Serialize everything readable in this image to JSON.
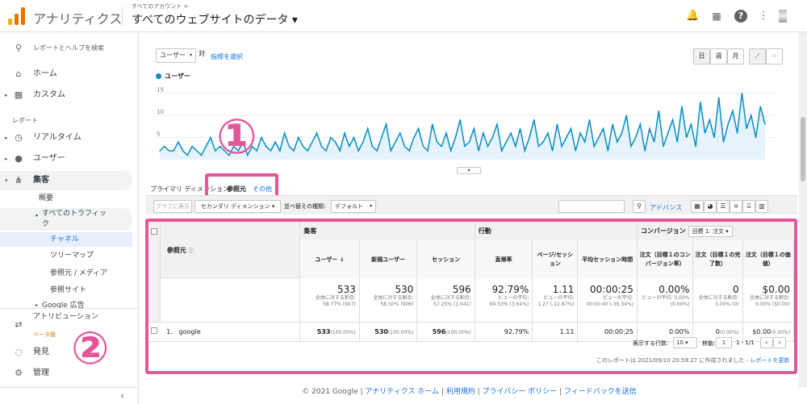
{
  "app": {
    "title": "アナリティクス",
    "account_small": "すべてのアカウント >",
    "property": "すべてのウェブサイトのデータ ▾"
  },
  "sidebar": {
    "search": "レポートとヘルプを検索",
    "home": "ホーム",
    "custom": "カスタム",
    "section_report": "レポート",
    "realtime": "リアルタイム",
    "users": "ユーザー",
    "acquisition": "集客",
    "overview": "概要",
    "all_traffic": "すべてのトラフィック",
    "channels": "チャネル",
    "treemap": "ツリーマップ",
    "source_medium": "参照元 / メディア",
    "referrals": "参照サイト",
    "google_ads": "Google 広告",
    "attribution": "アトリビューション",
    "beta": "ベータ版",
    "discover": "発見",
    "admin": "管理"
  },
  "chart_controls": {
    "metric_select": "ユーザー",
    "vs": "対",
    "select_metric": "指標を選択",
    "day": "日",
    "week": "週",
    "month": "月",
    "series_label": "ユーザー"
  },
  "chart_data": {
    "type": "line",
    "series": [
      {
        "name": "ユーザー",
        "values": [
          2,
          3,
          2,
          2,
          4,
          2,
          1,
          3,
          2,
          1,
          3,
          5,
          2,
          3,
          2,
          1,
          3,
          2,
          4,
          1,
          3,
          2,
          5,
          3,
          2,
          4,
          2,
          6,
          3,
          2,
          5,
          3,
          2,
          4,
          6,
          3,
          2,
          5,
          4,
          2,
          6,
          3,
          5,
          2,
          4,
          7,
          3,
          2,
          5,
          8,
          2,
          4,
          6,
          3,
          2,
          5,
          7,
          3,
          2,
          8,
          4,
          3,
          6,
          2,
          5,
          9,
          3,
          4,
          7,
          2,
          6,
          3,
          5,
          8,
          2,
          4,
          6,
          3,
          7,
          2,
          5,
          9,
          3,
          4,
          6,
          2,
          8,
          3,
          5,
          7,
          2,
          6,
          4,
          9,
          3,
          5,
          7,
          2,
          8,
          4,
          6,
          10,
          3,
          5,
          8,
          2,
          7,
          4,
          11,
          3,
          6,
          9,
          4,
          12,
          5,
          8,
          3,
          13,
          6,
          9,
          5,
          14,
          4,
          8,
          11,
          6,
          15,
          7,
          10,
          5,
          12,
          8
        ]
      }
    ],
    "y_ticks": [
      "15",
      "10",
      "5"
    ],
    "ylim": [
      0,
      16
    ]
  },
  "dimension": {
    "label": "プライマリ ディメンション:",
    "value": "参照元",
    "other": "その他"
  },
  "toolbar": {
    "plot": "グラフに表示",
    "secondary": "セカンダリ ディメンション ▾",
    "sort_label": "並べ替えの種類:",
    "sort_value": "デフォルト",
    "advanced": "アドバンス"
  },
  "table": {
    "col_source": "参照元",
    "grp_acq": "集客",
    "grp_behavior": "行動",
    "grp_conv": "コンバージョン",
    "goal_select": "目標 1: 注文",
    "headers": [
      "ユーザー",
      "新規ユーザー",
      "セッション",
      "直帰率",
      "ページ/セッション",
      "平均セッション時間",
      "注文（目標１のコンバージョン率）",
      "注文（目標１の完了数）",
      "注文（目標１の価値）"
    ],
    "totals": [
      "533",
      "530",
      "596",
      "92.79%",
      "1.11",
      "00:00:25",
      "0.00%",
      "0",
      "$0.00"
    ],
    "totals_sub": [
      "全体に対する割合: 58.77% (907)",
      "全体に対する割合: 58.50% (906)",
      "全体に対する割合: 57.25% (1,041)",
      "ビューの平均: 89.53% (3.64%)",
      "ビューの平均: 1.27 (-12.87%)",
      "ビューの平均: 00:00:40 (-36.34%)",
      "ビューの平均: 0.00% (0.00%)",
      "全体に対する割合: 0.00% (0)",
      "全体に対する割合: 0.00% ($0.00)"
    ],
    "row_index": "1.",
    "row_source": "google",
    "row_vals": [
      "533",
      "530",
      "596",
      "92.79%",
      "1.11",
      "00:00:25",
      "0.00%",
      "0",
      "$0.00"
    ],
    "row_pcts": [
      "(100.00%)",
      "(100.00%)",
      "(100.00%)",
      "",
      "",
      "",
      "",
      "(0.00%)",
      "(0.00%)"
    ],
    "rows_label": "表示する行数:",
    "rows_value": "10",
    "goto_label": "移動:",
    "goto_value": "1",
    "range": "1 - 1/1",
    "generated": "このレポートは 2021/09/10 20:59:27 に作成されました -",
    "refresh": "レポートを更新"
  },
  "annotations": {
    "one": "①",
    "two": "②"
  },
  "footer": {
    "copyright": "© 2021 Google",
    "links": [
      "アナリティクス ホーム",
      "利用規約",
      "プライバシー ポリシー",
      "フィードバックを送信"
    ]
  },
  "colors": {
    "accent": "#1a73e8",
    "pink": "#e6559a",
    "chart": "#058dc7"
  }
}
